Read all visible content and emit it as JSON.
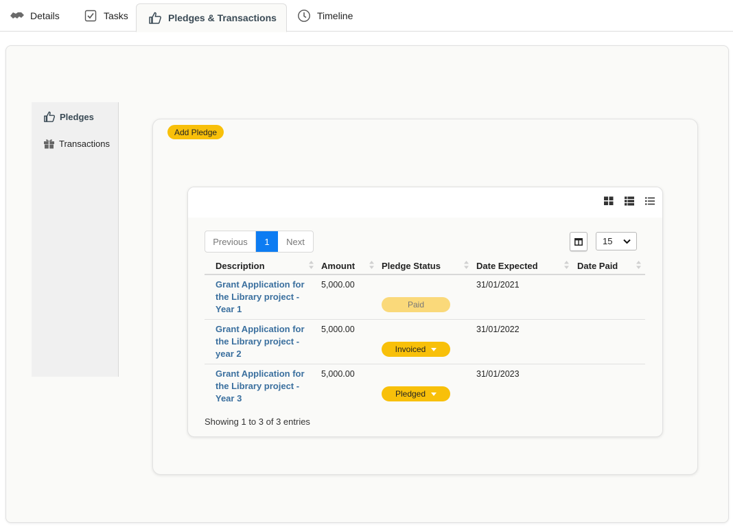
{
  "tabs": [
    {
      "label": "Details",
      "icon": "handshake-icon",
      "active": false
    },
    {
      "label": "Tasks",
      "icon": "checkbox-icon",
      "active": false
    },
    {
      "label": "Pledges & Transactions",
      "icon": "thumbs-up-icon",
      "active": true
    },
    {
      "label": "Timeline",
      "icon": "clock-icon",
      "active": false
    }
  ],
  "sidebar": {
    "items": [
      {
        "label": "Pledges",
        "icon": "thumbs-up-icon",
        "active": true
      },
      {
        "label": "Transactions",
        "icon": "gift-icon",
        "active": false
      }
    ]
  },
  "add_pledge_label": "Add Pledge",
  "view_icons": [
    "grid-view-icon",
    "list-detail-view-icon",
    "list-view-icon"
  ],
  "pagination": {
    "previous": "Previous",
    "current": "1",
    "next": "Next"
  },
  "page_size": "15",
  "table": {
    "columns": [
      "Description",
      "Amount",
      "Pledge Status",
      "Date Expected",
      "Date Paid"
    ],
    "rows": [
      {
        "description": "Grant Application for the Library project - Year 1",
        "amount": "5,000.00",
        "status": "Paid",
        "date_expected": "31/01/2021",
        "date_paid": ""
      },
      {
        "description": "Grant Application for the Library project - year 2",
        "amount": "5,000.00",
        "status": "Invoiced",
        "date_expected": "31/01/2022",
        "date_paid": ""
      },
      {
        "description": "Grant Application for the Library project - Year 3",
        "amount": "5,000.00",
        "status": "Pledged",
        "date_expected": "31/01/2023",
        "date_paid": ""
      }
    ]
  },
  "footer_text": "Showing 1 to 3 of 3 entries",
  "colors": {
    "accent": "#f8c00a",
    "link": "#3a6f9e",
    "pager_active": "#0d7cf2"
  }
}
